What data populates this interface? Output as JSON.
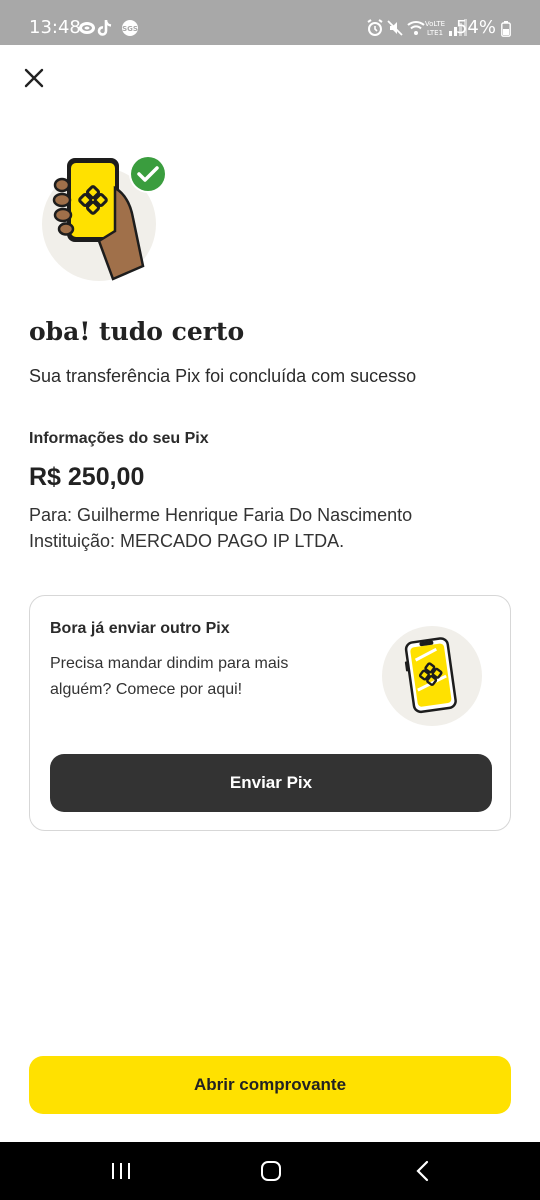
{
  "status_bar": {
    "time": "13:48",
    "battery": "54%",
    "left_icons": [
      "app-notification-icon",
      "tiktok-icon",
      "badge-icon"
    ],
    "right_icons": [
      "alarm-icon",
      "mute-icon",
      "wifi-icon",
      "volte-lte-icon",
      "signal-icon",
      "battery-icon"
    ]
  },
  "header": {
    "close_icon": "close-icon"
  },
  "hero": {
    "icon": "hand-phone-pix-success-illustration"
  },
  "main": {
    "title": "oba! tudo certo",
    "subtitle": "Sua transferência Pix foi concluída com sucesso"
  },
  "info": {
    "heading": "Informações do seu Pix",
    "amount": "R$ 250,00",
    "recipient": "Para: Guilherme Henrique Faria Do Nascimento",
    "institution": "Instituição: MERCADO PAGO IP LTDA."
  },
  "card": {
    "title": "Bora já enviar outro Pix",
    "description": "Precisa mandar dindim para mais alguém? Comece por aqui!",
    "illustration": "phone-pix-illustration",
    "button_label": "Enviar Pix"
  },
  "footer": {
    "button_label": "Abrir comprovante"
  },
  "nav": {
    "icons": [
      "recents-icon",
      "home-icon",
      "back-icon"
    ]
  },
  "colors": {
    "accent_yellow": "#ffe100",
    "dark_button": "#333333",
    "success_green": "#3a9d3e",
    "status_bar": "#a8a8a8"
  }
}
